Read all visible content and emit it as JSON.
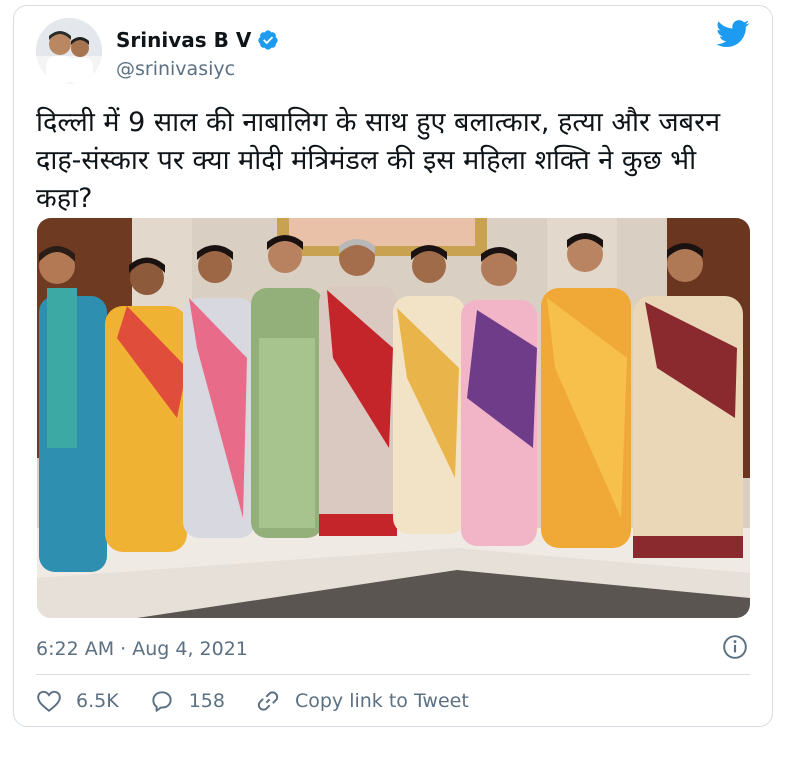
{
  "author": {
    "display_name": "Srinivas B V",
    "handle": "@srinivasiyc",
    "verified_icon": "verified-badge-icon",
    "avatar_icon": "avatar"
  },
  "brand": {
    "icon": "twitter-bird-icon",
    "color": "#1d9bf0"
  },
  "tweet": {
    "text": "दिल्ली में 9 साल की नाबालिग के साथ हुए बलात्कार, हत्या और जबरन दाह-संस्कार पर क्या मोदी मंत्रिमंडल की इस महिला शक्ति ने कुछ भी कहा?",
    "timestamp": "6:22 AM · Aug 4, 2021"
  },
  "actions": {
    "likes": "6.5K",
    "replies": "158",
    "copy_link_label": "Copy link to Tweet"
  },
  "colors": {
    "text_primary": "#0f1419",
    "text_secondary": "#5b7083",
    "border": "#d7dde2",
    "accent": "#1d9bf0"
  }
}
